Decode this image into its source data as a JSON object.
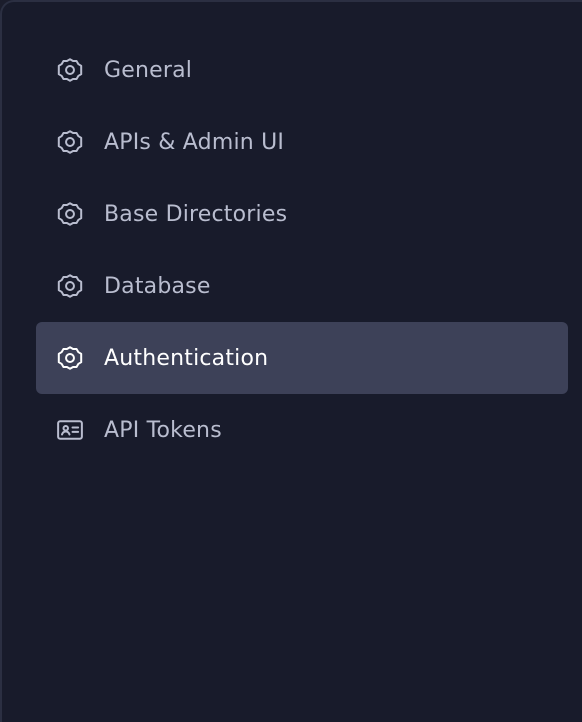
{
  "settings_nav": {
    "items": [
      {
        "label": "General",
        "icon": "gear-icon",
        "active": false
      },
      {
        "label": "APIs & Admin UI",
        "icon": "gear-icon",
        "active": false
      },
      {
        "label": "Base Directories",
        "icon": "gear-icon",
        "active": false
      },
      {
        "label": "Database",
        "icon": "gear-icon",
        "active": false
      },
      {
        "label": "Authentication",
        "icon": "gear-icon",
        "active": true
      },
      {
        "label": "API Tokens",
        "icon": "id-card-icon",
        "active": false
      }
    ]
  },
  "colors": {
    "background": "#181b2b",
    "active_item_background": "#3d4158",
    "text": "#b9bdcf",
    "active_text": "#ffffff"
  }
}
